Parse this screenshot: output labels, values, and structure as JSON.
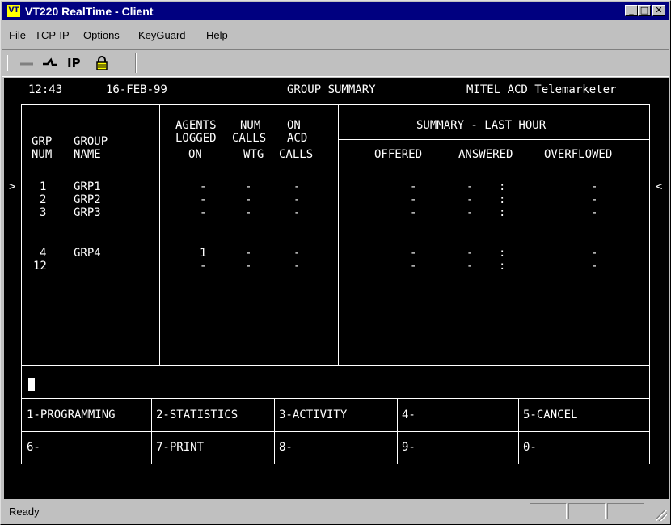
{
  "window": {
    "title": "VT220 RealTime - Client",
    "app_icon": "VT",
    "min_glyph": "_",
    "max_glyph": "□",
    "close_glyph": "✕"
  },
  "menu": {
    "file": "File",
    "tcpip": "TCP-IP",
    "options": "Options",
    "keyguard": "KeyGuard",
    "help": "Help"
  },
  "toolbar": {
    "icons": [
      "disconnect-icon",
      "connect-icon",
      "ip-icon",
      "lock-icon"
    ],
    "connect_glyph": "⌇",
    "ip_label": "IP"
  },
  "terminal": {
    "time": "12:43",
    "date": "16-FEB-99",
    "screen_title": "GROUP SUMMARY",
    "product": "MITEL ACD Telemarketer",
    "headers": {
      "grp": "GRP",
      "num": "NUM",
      "group": "GROUP",
      "name": "NAME",
      "agents": "AGENTS",
      "logged": "LOGGED",
      "on": "ON",
      "num2": "NUM",
      "calls": "CALLS",
      "wtg": "WTG",
      "on2": "ON",
      "acd": "ACD",
      "calls2": "CALLS",
      "summary": "SUMMARY - LAST HOUR",
      "offered": "OFFERED",
      "answered": "ANSWERED",
      "overflowed": "OVERFLOWED"
    },
    "rows": [
      {
        "num": "1",
        "name": "GRP1",
        "logged": "-",
        "wtg": "-",
        "acd": "-",
        "offered": "-",
        "answered": "-",
        "sep": ":",
        "overflowed": "-"
      },
      {
        "num": "2",
        "name": "GRP2",
        "logged": "-",
        "wtg": "-",
        "acd": "-",
        "offered": "-",
        "answered": "-",
        "sep": ":",
        "overflowed": "-"
      },
      {
        "num": "3",
        "name": "GRP3",
        "logged": "-",
        "wtg": "-",
        "acd": "-",
        "offered": "-",
        "answered": "-",
        "sep": ":",
        "overflowed": "-"
      },
      {
        "num": "4",
        "name": "GRP4",
        "logged": "1",
        "wtg": "-",
        "acd": "-",
        "offered": "-",
        "answered": "-",
        "sep": ":",
        "overflowed": "-"
      },
      {
        "num": "12",
        "name": "",
        "logged": "-",
        "wtg": "-",
        "acd": "-",
        "offered": "-",
        "answered": "-",
        "sep": ":",
        "overflowed": "-"
      }
    ],
    "left_marker": ">",
    "right_marker": "<",
    "softkeys": [
      "1-PROGRAMMING",
      "2-STATISTICS",
      "3-ACTIVITY",
      "4-",
      "5-CANCEL",
      "6-",
      "7-PRINT",
      "8-",
      "9-",
      "0-"
    ]
  },
  "status": {
    "text": "Ready"
  }
}
